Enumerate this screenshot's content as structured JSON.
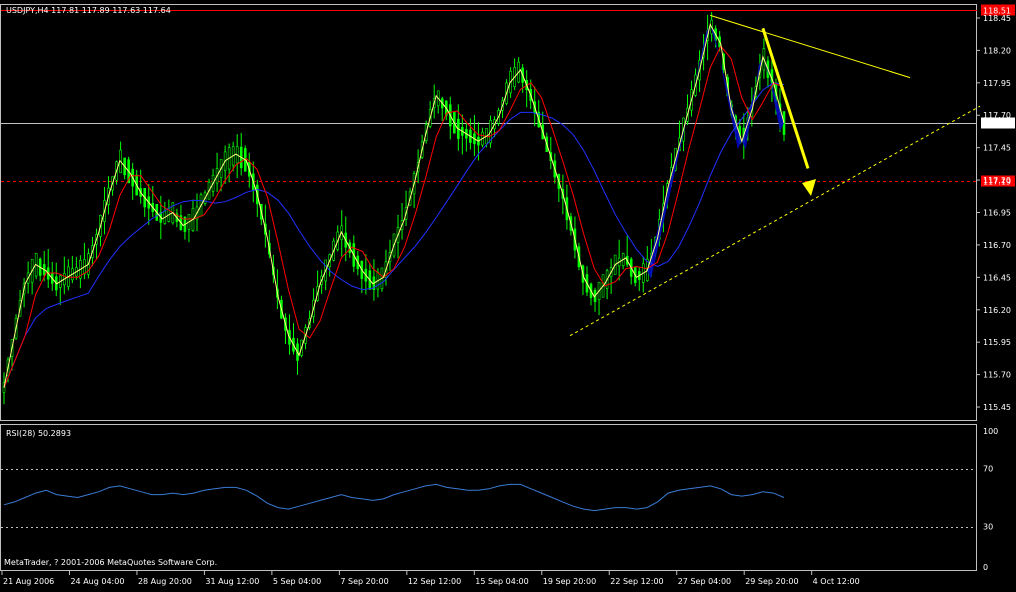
{
  "header": {
    "label": "USDJPY,H4  117.81 117.89 117.63 117.64"
  },
  "rsi_header": {
    "label": "RSI(28) 50.2893"
  },
  "footer": {
    "copyright": "MetaTrader, ? 2001-2006 MetaQuotes Software Corp."
  },
  "colors": {
    "background": "#000000",
    "grid_border": "#c0c0c0",
    "bull_candle": "#00ff00",
    "wick_white": "#ffffff",
    "ma_fast": "#ffff80",
    "ma_mid": "#ff0000",
    "ma_slow": "#2030ff",
    "rsi": "#3a7bd5",
    "trendline": "#ffff00",
    "pattern_fill": "#0000cc"
  },
  "chart_data": [
    {
      "type": "candlestick",
      "symbol": "USDJPY",
      "timeframe": "H4",
      "ohlc_last": {
        "open": 117.81,
        "high": 117.89,
        "low": 117.63,
        "close": 117.64
      },
      "ylim": [
        115.35,
        118.55
      ],
      "y_ticks": [
        "118.45",
        "118.20",
        "117.95",
        "117.70",
        "117.45",
        "117.20",
        "116.95",
        "116.70",
        "116.45",
        "116.20",
        "115.95",
        "115.70",
        "115.45"
      ],
      "x_ticks": [
        "21 Aug 2006",
        "24 Aug 04:00",
        "28 Aug 20:00",
        "31 Aug 12:00",
        "5 Sep 04:00",
        "7 Sep 20:00",
        "12 Sep 12:00",
        "15 Sep 04:00",
        "19 Sep 20:00",
        "22 Sep 12:00",
        "27 Sep 04:00",
        "29 Sep 20:00",
        "4 Oct 12:00"
      ],
      "price_levels": [
        {
          "label": "118.51",
          "value": 118.51,
          "style": "solid",
          "color": "#ff0000"
        },
        {
          "label": "117.64",
          "value": 117.64,
          "style": "solid",
          "color": "#c0c0c0"
        },
        {
          "label": "117.19",
          "value": 117.19,
          "style": "dashed",
          "color": "#ff0000"
        }
      ],
      "series": [
        {
          "key": "close",
          "values": [
            115.6,
            116.0,
            116.4,
            116.55,
            116.5,
            116.4,
            116.45,
            116.5,
            116.55,
            116.8,
            117.1,
            117.35,
            117.25,
            117.1,
            117.0,
            116.9,
            116.95,
            116.85,
            116.9,
            117.05,
            117.2,
            117.35,
            117.4,
            117.35,
            117.1,
            116.75,
            116.3,
            116.0,
            115.85,
            116.1,
            116.4,
            116.6,
            116.8,
            116.65,
            116.5,
            116.4,
            116.45,
            116.7,
            116.9,
            117.2,
            117.55,
            117.85,
            117.75,
            117.6,
            117.55,
            117.5,
            117.55,
            117.7,
            117.95,
            118.05,
            117.85,
            117.6,
            117.35,
            117.1,
            116.8,
            116.45,
            116.3,
            116.4,
            116.55,
            116.6,
            116.45,
            116.5,
            116.75,
            117.15,
            117.45,
            117.75,
            118.05,
            118.4,
            118.25,
            117.75,
            117.5,
            117.75,
            118.15,
            117.95,
            117.64
          ]
        },
        {
          "key": "rsi",
          "name": "RSI(28)",
          "values": [
            45,
            47,
            50,
            53,
            55,
            52,
            51,
            50,
            52,
            54,
            57,
            58,
            56,
            54,
            52,
            52,
            53,
            52,
            53,
            55,
            56,
            57,
            57,
            55,
            51,
            46,
            43,
            42,
            44,
            46,
            48,
            50,
            52,
            50,
            49,
            48,
            49,
            52,
            54,
            56,
            58,
            59,
            57,
            56,
            55,
            55,
            56,
            58,
            59,
            59,
            56,
            53,
            50,
            47,
            44,
            42,
            41,
            42,
            43,
            43,
            42,
            43,
            47,
            53,
            55,
            56,
            57,
            58,
            56,
            52,
            51,
            52,
            54,
            53,
            50
          ]
        }
      ]
    },
    {
      "type": "line",
      "name": "RSI(28)",
      "ylim": [
        0,
        100
      ],
      "y_ticks": [
        "100",
        "70",
        "30",
        "0"
      ],
      "levels": [
        70,
        30
      ]
    }
  ]
}
